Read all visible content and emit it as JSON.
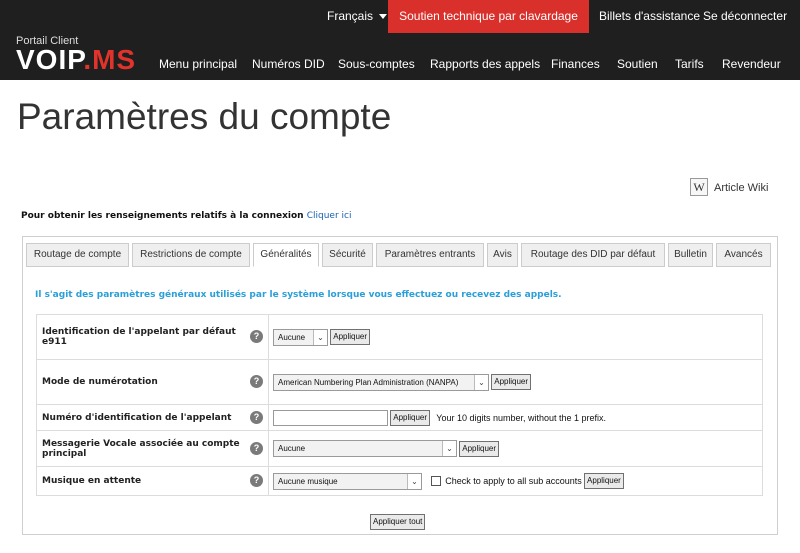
{
  "header": {
    "language": "Français",
    "chat_label": "Soutien technique par clavardage",
    "tickets_label": "Billets d'assistance",
    "logout_label": "Se déconnecter",
    "portal_label": "Portail Client",
    "logo_main": "VOIP",
    "logo_accent": ".MS",
    "nav": [
      "Menu principal",
      "Numéros DID",
      "Sous-comptes",
      "Rapports des appels",
      "Finances",
      "Soutien",
      "Tarifs",
      "Revendeur"
    ]
  },
  "page": {
    "title": "Paramètres du compte",
    "wiki_glyph": "W",
    "wiki_label": "Article Wiki",
    "connection_text": "Pour obtenir les renseignements relatifs à la connexion",
    "connection_link": "Cliquer ici"
  },
  "tabs": [
    "Routage de compte",
    "Restrictions de compte",
    "Généralités",
    "Sécurité",
    "Paramètres entrants",
    "Avis",
    "Routage des DID par défaut",
    "Bulletin",
    "Avancés"
  ],
  "active_tab": "Généralités",
  "info_text": "Il s'agit des paramètres généraux utilisés par le système lorsque vous effectuez ou recevez des appels.",
  "help_glyph": "?",
  "dropdown_glyph": "⌄",
  "settings": {
    "e911": {
      "label": "Identification de l'appelant par défaut e911",
      "value": "Aucune",
      "button": "Appliquer"
    },
    "dial_mode": {
      "label": "Mode de numérotation",
      "value": "American Numbering Plan Administration (NANPA)",
      "button": "Appliquer"
    },
    "caller_id": {
      "label": "Numéro d'identification de l'appelant",
      "value": "",
      "button": "Appliquer",
      "note": "Your 10 digits number, without the 1 prefix."
    },
    "voicemail": {
      "label": "Messagerie Vocale associée au compte principal",
      "value": "Aucune",
      "button": "Appliquer"
    },
    "hold_music": {
      "label": "Musique en attente",
      "value": "Aucune musique",
      "button": "Appliquer",
      "checkbox_label": "Check to apply to all sub accounts"
    }
  },
  "apply_all_label": "Appliquer tout",
  "colors": {
    "topbar": "#1f1f1f",
    "chat": "#d9302c",
    "info": "#2a9fd8",
    "link": "#1a5fb4"
  }
}
